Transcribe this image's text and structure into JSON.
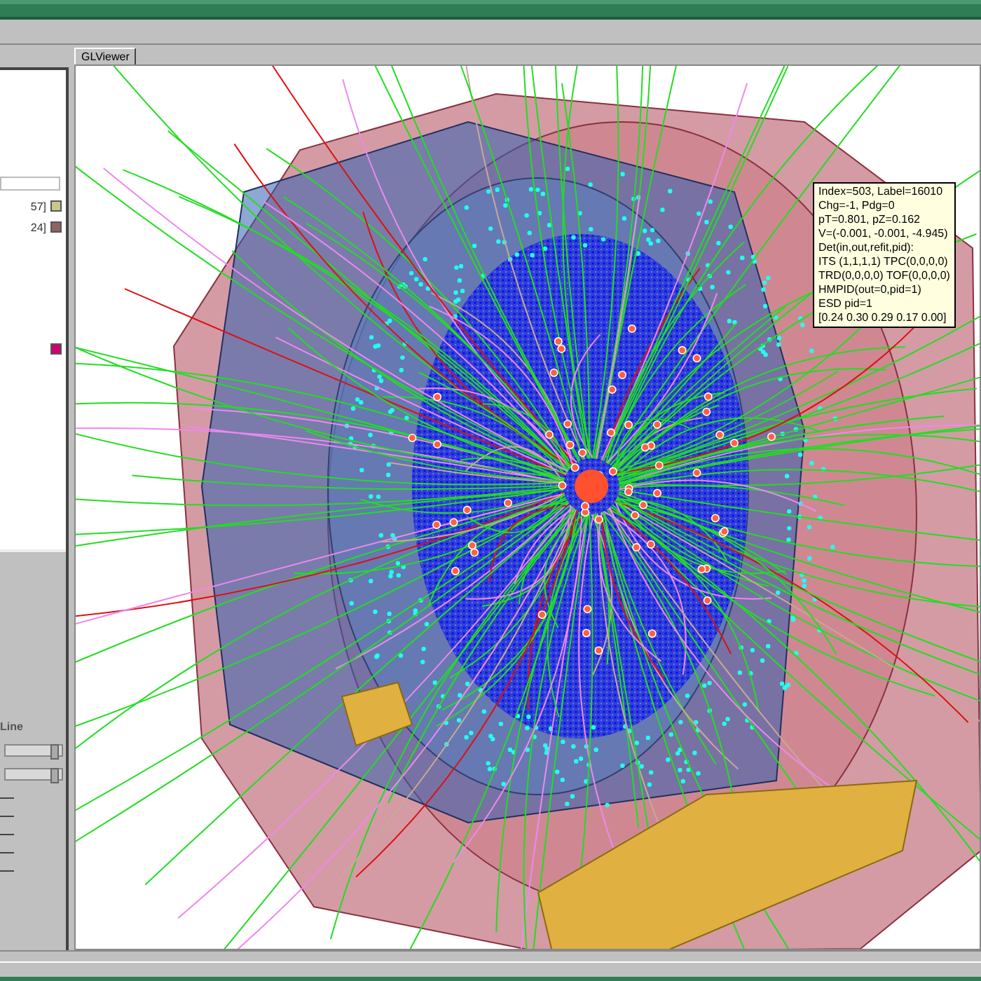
{
  "viewer_tab": {
    "label": "GLViewer",
    "selected": true
  },
  "left_panel": {
    "list_items": [
      {
        "text": "57]",
        "color": "#c8c88c"
      },
      {
        "text": "24]",
        "color": "#8c6464"
      },
      {
        "color": "#d0006e"
      }
    ],
    "label": "Line",
    "sliders": [
      {
        "level": 0.9
      },
      {
        "level": 0.9
      }
    ]
  },
  "tooltip": {
    "lines": [
      "Index=503, Label=16010",
      "Chg=-1, Pdg=0",
      "pT=0.801, pZ=0.162",
      "V=(-0.001, -0.001, -4.945)",
      "Det(in,out,refit,pid):",
      "ITS (1,1,1,1)  TPC(0,0,0,0)",
      "TRD(0,0,0,0)  TOF(0,0,0,0)",
      "HMPID(out=0,pid=1)",
      "ESD pid=1",
      "[0.24 0.30 0.29 0.17 0.00]"
    ]
  }
}
